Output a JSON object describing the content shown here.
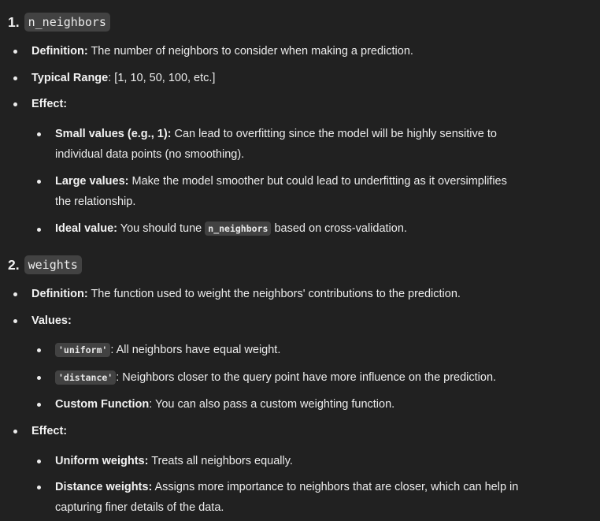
{
  "section1": {
    "num": "1.",
    "code": "n_neighbors",
    "definition_label": "Definition:",
    "definition_text": " The number of neighbors to consider when making a prediction.",
    "range_label": "Typical Range",
    "range_text": ": [1, 10, 50, 100, etc.]",
    "effect_label": "Effect:",
    "small_label": "Small values (e.g., 1):",
    "small_text_1": " Can lead to overfitting since the model will be highly sensitive to",
    "small_text_2": "individual data points (no smoothing).",
    "large_label": "Large values:",
    "large_text_1": " Make the model smoother but could lead to underfitting as it oversimplifies",
    "large_text_2": "the relationship.",
    "ideal_label": "Ideal value:",
    "ideal_text_a": " You should tune ",
    "ideal_code": "n_neighbors",
    "ideal_text_b": " based on cross-validation."
  },
  "section2": {
    "num": "2.",
    "code": "weights",
    "definition_label": "Definition:",
    "definition_text": " The function used to weight the neighbors' contributions to the prediction.",
    "values_label": "Values:",
    "uniform_code": "'uniform'",
    "uniform_text": ": All neighbors have equal weight.",
    "distance_code": "'distance'",
    "distance_text": ": Neighbors closer to the query point have more influence on the prediction.",
    "custom_label": "Custom Function",
    "custom_text": ": You can also pass a custom weighting function.",
    "effect_label": "Effect:",
    "uw_label": "Uniform weights:",
    "uw_text": " Treats all neighbors equally.",
    "dw_label": "Distance weights:",
    "dw_text_1": " Assigns more importance to neighbors that are closer, which can help in",
    "dw_text_2": "capturing finer details of the data."
  }
}
